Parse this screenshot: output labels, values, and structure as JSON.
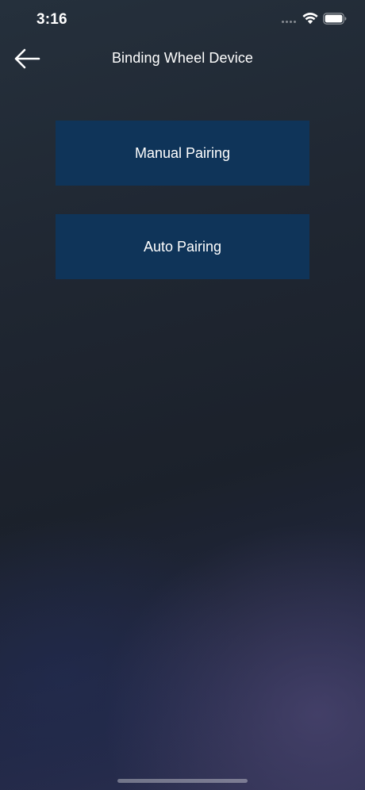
{
  "status_bar": {
    "time": "3:16",
    "icons": [
      "signal-dots-icon",
      "wifi-icon",
      "battery-icon"
    ]
  },
  "nav": {
    "back_icon": "arrow-left-icon",
    "title": "Binding Wheel Device"
  },
  "options": {
    "manual_label": "Manual Pairing",
    "auto_label": "Auto Pairing"
  },
  "colors": {
    "button_bg": "#0f3459",
    "text": "#ffffff"
  }
}
